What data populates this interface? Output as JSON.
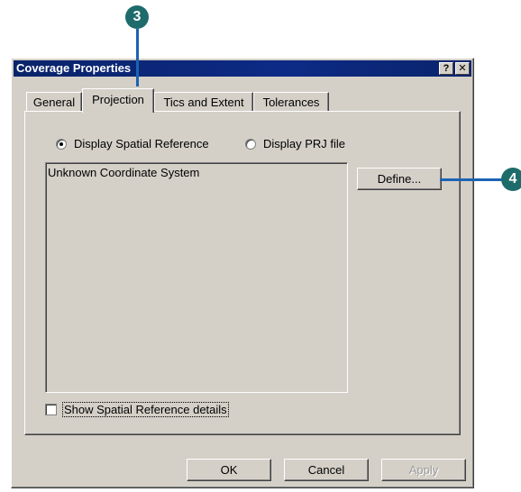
{
  "dialog": {
    "title": "Coverage Properties",
    "help_button": "?",
    "close_button": "✕"
  },
  "tabs": [
    "General",
    "Projection",
    "Tics and Extent",
    "Tolerances"
  ],
  "active_tab": "Projection",
  "projection": {
    "radio_display_spatial": "Display Spatial Reference",
    "radio_display_prj": "Display PRJ file",
    "selected_radio": "Display Spatial Reference",
    "listbox_text": "Unknown Coordinate System",
    "define_button": "Define...",
    "show_details_checkbox": "Show Spatial Reference details",
    "show_details_checked": false
  },
  "footer": {
    "ok": "OK",
    "cancel": "Cancel",
    "apply": "Apply"
  },
  "callouts": [
    "3",
    "4"
  ],
  "colors": {
    "title_bar": "#0a246a",
    "dialog_face": "#d4d0c8",
    "callout_circle": "#1d6b6a",
    "leader_line": "#1c63b3"
  }
}
